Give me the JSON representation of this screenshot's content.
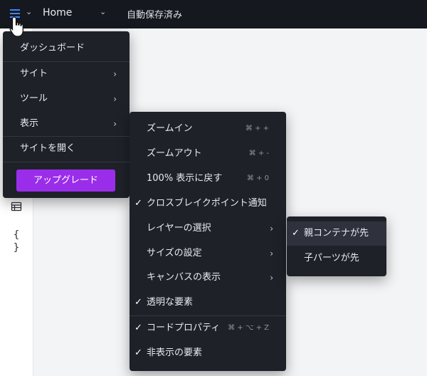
{
  "topbar": {
    "menu_icon": "hamburger-icon",
    "page_name": "Home",
    "status": "自動保存済み"
  },
  "main_menu": {
    "items": [
      {
        "label": "ダッシュボード"
      },
      {
        "label": "サイト"
      },
      {
        "label": "ツール"
      },
      {
        "label": "表示"
      },
      {
        "label": "サイトを開く"
      }
    ],
    "upgrade_label": "アップグレード"
  },
  "view_menu": {
    "items": [
      {
        "label": "ズームイン",
        "shortcut": "⌘ + +"
      },
      {
        "label": "ズームアウト",
        "shortcut": "⌘ + -"
      },
      {
        "label": "100% 表示に戻す",
        "shortcut": "⌘ + 0"
      },
      {
        "label": "クロスブレイクポイント通知",
        "checked": true
      },
      {
        "label": "レイヤーの選択"
      },
      {
        "label": "サイズの設定"
      },
      {
        "label": "キャンバスの表示"
      },
      {
        "label": "透明な要素",
        "checked": true
      },
      {
        "label": "コードプロパティ",
        "shortcut": "⌘ + ⌥ + Z",
        "checked": true
      },
      {
        "label": "非表示の要素",
        "checked": true
      }
    ]
  },
  "layer_menu": {
    "items": [
      {
        "label": "親コンテナが先",
        "checked": true
      },
      {
        "label": "子パーツが先"
      }
    ]
  },
  "colors": {
    "accent": "#3d86ff",
    "upgrade": "#9a2dea",
    "menu_bg": "#1f2129",
    "topbar_bg": "#16181f"
  }
}
